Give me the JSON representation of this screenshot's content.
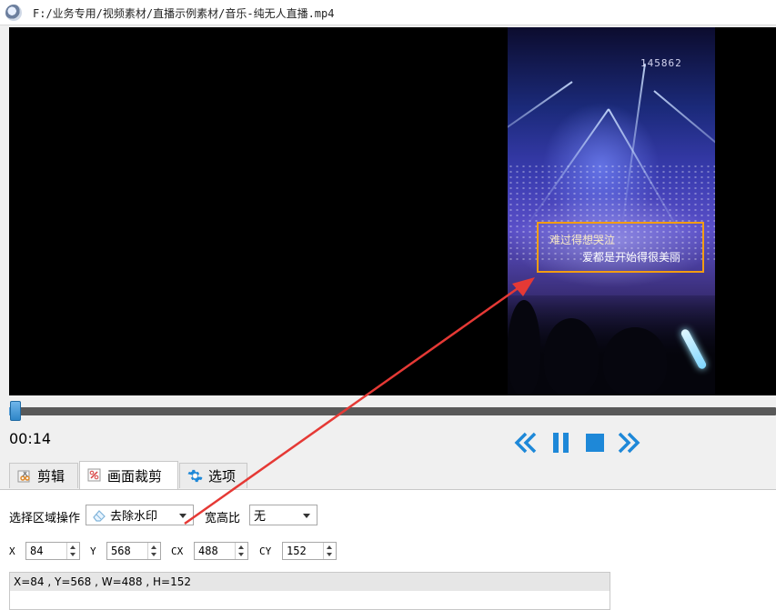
{
  "window": {
    "title": "F:/业务专用/视频素材/直播示例素材/音乐-纯无人直播.mp4"
  },
  "video": {
    "screen_code": "145862",
    "lyric_line1": "难过得想哭泣",
    "lyric_line2": "爱都是开始得很美丽"
  },
  "player": {
    "time": "00:14",
    "progress_fraction": 0.015,
    "controls": [
      "rewind-icon",
      "pause-icon",
      "stop-icon",
      "fast-forward-icon"
    ]
  },
  "tabs": [
    {
      "label": "剪辑",
      "icon": "scissors-icon"
    },
    {
      "label": "画面裁剪",
      "icon": "crop-icon",
      "active": true
    },
    {
      "label": "选项",
      "icon": "gear-icon"
    }
  ],
  "crop": {
    "region_op_label": "选择区域操作",
    "region_op_value": "去除水印",
    "aspect_label": "宽高比",
    "aspect_value": "无",
    "x_label": "X",
    "x_value": "84",
    "y_label": "Y",
    "y_value": "568",
    "cx_label": "CX",
    "cx_value": "488",
    "cy_label": "CY",
    "cy_value": "152",
    "status": "X=84 , Y=568 , W=488 , H=152"
  },
  "colors": {
    "accent": "#1e88d8",
    "selection": "#f39c12",
    "annotation": "#e53935"
  }
}
